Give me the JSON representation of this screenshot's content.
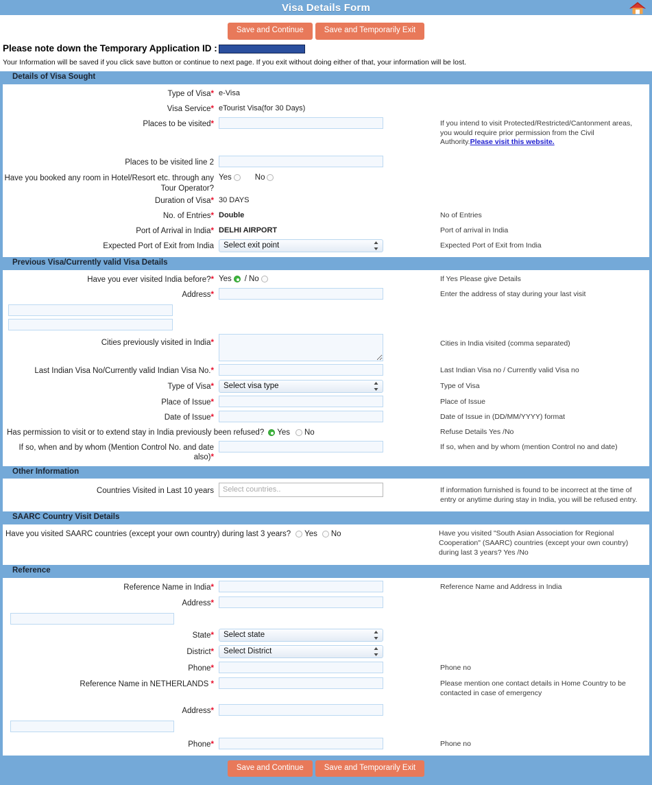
{
  "titlebar": {
    "title": "Visa Details Form",
    "home_icon": "home-icon"
  },
  "top": {
    "save_continue": "Save and Continue",
    "save_exit": "Save and Temporarily Exit",
    "appid_label": "Please note down the Temporary Application ID :",
    "appid_value": "",
    "note": "Your Information will be saved if you click save button or continue to next page. If you exit without doing either of that, your information will be lost."
  },
  "sections": {
    "visa_sought": {
      "heading": "Details of Visa Sought",
      "type_of_visa_label": "Type of Visa",
      "type_of_visa_value": "e-Visa",
      "visa_service_label": "Visa Service",
      "visa_service_value": "eTourist Visa(for 30 Days)",
      "places_label": "Places to be visited",
      "places_value": "",
      "places_help_1": "If you intend to visit Protected/Restricted/Cantonment areas, you would require prior permission from the Civil Authority.",
      "places_help_link": "Please visit this website.",
      "places2_label": "Places to be visited line 2",
      "places2_value": "",
      "hotel_label": "Have you booked any room in Hotel/Resort etc. through any Tour Operator?",
      "hotel_yes": "Yes",
      "hotel_no": "No",
      "hotel_selected": "",
      "duration_label": "Duration of Visa",
      "duration_value": "30 DAYS",
      "entries_label": "No. of Entries",
      "entries_value": "Double",
      "entries_help": "No of Entries",
      "arrival_label": "Port of Arrival in India",
      "arrival_value": "DELHI AIRPORT",
      "arrival_help": "Port of arrival in India",
      "exit_label": "Expected Port of Exit from India",
      "exit_value": "Select exit point",
      "exit_help": "Expected Port of Exit from India"
    },
    "previous_visa": {
      "heading": "Previous Visa/Currently valid Visa Details",
      "visited_label": "Have you ever visited India before?",
      "visited_yes": "Yes",
      "visited_sep": "/",
      "visited_no": "No",
      "visited_selected": "Yes",
      "visited_help": "If Yes Please give Details",
      "address_label": "Address",
      "address_value": "",
      "address_help": "Enter the address of stay during your last visit",
      "address_line2": "",
      "address_line3": "",
      "cities_label": "Cities previously visited in India",
      "cities_value": "",
      "cities_help": "Cities in India visited (comma separated)",
      "lastvisa_label": "Last Indian Visa No/Currently valid Indian Visa No.",
      "lastvisa_value": "",
      "lastvisa_help": "Last Indian Visa no / Currently valid Visa no",
      "type_label": "Type of Visa",
      "type_value": "Select visa type",
      "type_help": "Type of Visa",
      "place_label": "Place of Issue",
      "place_value": "",
      "place_help": "Place of Issue",
      "date_label": "Date of Issue",
      "date_value": "",
      "date_help": "Date of Issue in (DD/MM/YYYY) format",
      "refused_label": "Has permission to visit or to extend stay in India previously been refused?",
      "refused_yes": "Yes",
      "refused_no": "No",
      "refused_selected": "Yes",
      "refused_help": "Refuse Details Yes /No",
      "ifso_label": "If so, when and by whom (Mention Control No. and date also)",
      "ifso_value": "",
      "ifso_help": "If so, when and by whom (mention Control no and date)"
    },
    "other_info": {
      "heading": "Other Information",
      "countries_label": "Countries Visited in Last 10 years",
      "countries_placeholder": "Select countries..",
      "countries_help": "If information furnished is found to be incorrect at the time of entry or anytime during stay in India, you will be refused entry."
    },
    "saarc": {
      "heading": "SAARC Country Visit Details",
      "question": "Have you visited SAARC countries (except your own country) during last 3 years?",
      "yes": "Yes",
      "no": "No",
      "selected": "",
      "help": "Have you visited \"South Asian Association for Regional Cooperation\" (SAARC) countries (except your own country) during last 3 years? Yes /No"
    },
    "reference": {
      "heading": "Reference",
      "ref_india_label": "Reference Name in India",
      "ref_india_value": "",
      "ref_india_help": "Reference Name and Address in India",
      "address_label": "Address",
      "address_value": "",
      "address_line2": "",
      "state_label": "State",
      "state_value": "Select state",
      "district_label": "District",
      "district_value": "Select District",
      "phone_label": "Phone",
      "phone_value": "",
      "phone_help": "Phone no",
      "ref_home_label": "Reference Name in NETHERLANDS",
      "ref_home_value": "",
      "ref_home_help": "Please mention one contact details in Home Country to be contacted in case of emergency",
      "address2_label": "Address",
      "address2_value": "",
      "address2_line2": "",
      "phone2_label": "Phone",
      "phone2_value": "",
      "phone2_help": "Phone no"
    }
  },
  "footer": {
    "save_continue": "Save and Continue",
    "save_exit": "Save and Temporarily Exit"
  },
  "colors": {
    "accent_blue": "#74a9d8",
    "button_orange": "#e8795a",
    "required_red": "#e8112d",
    "link_blue": "#2020d0",
    "radio_green": "#3fb63f",
    "redaction_blue": "#2b4f9e"
  }
}
